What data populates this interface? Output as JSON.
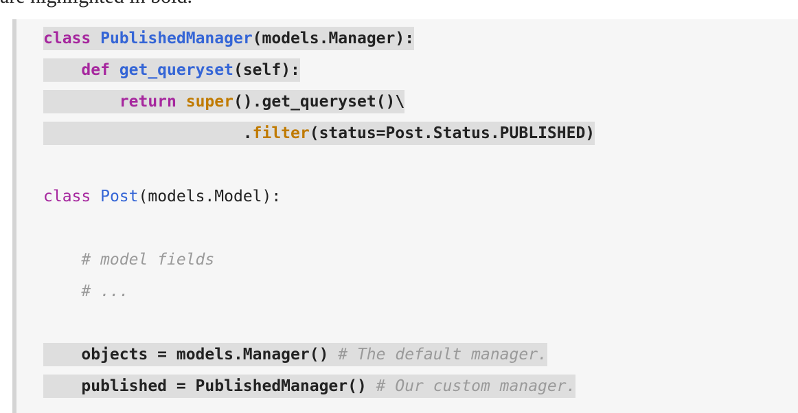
{
  "intro_text": "are highlighted in bold.",
  "code_lines": [
    {
      "highlighted": true,
      "tokens": [
        {
          "t": "class",
          "c": "kw"
        },
        {
          "t": " ",
          "c": "pl"
        },
        {
          "t": "PublishedManager",
          "c": "fn"
        },
        {
          "t": "(models.Manager):",
          "c": "pl"
        }
      ]
    },
    {
      "highlighted": true,
      "tokens": [
        {
          "t": "    ",
          "c": "pl"
        },
        {
          "t": "def",
          "c": "kw"
        },
        {
          "t": " ",
          "c": "pl"
        },
        {
          "t": "get_queryset",
          "c": "fn"
        },
        {
          "t": "(self):",
          "c": "pl"
        }
      ]
    },
    {
      "highlighted": true,
      "tokens": [
        {
          "t": "        ",
          "c": "pl"
        },
        {
          "t": "return",
          "c": "kw"
        },
        {
          "t": " ",
          "c": "pl"
        },
        {
          "t": "super",
          "c": "bi"
        },
        {
          "t": "().get_queryset()\\",
          "c": "pl"
        }
      ]
    },
    {
      "highlighted": true,
      "tokens": [
        {
          "t": "                     .",
          "c": "pl"
        },
        {
          "t": "filter",
          "c": "bi"
        },
        {
          "t": "(status=Post.Status.PUBLISHED)",
          "c": "pl"
        }
      ]
    },
    {
      "highlighted": false,
      "tokens": []
    },
    {
      "highlighted": false,
      "tokens": [
        {
          "t": "class",
          "c": "kw"
        },
        {
          "t": " ",
          "c": "pl"
        },
        {
          "t": "Post",
          "c": "fn"
        },
        {
          "t": "(models.Model):",
          "c": "pl"
        }
      ]
    },
    {
      "highlighted": false,
      "tokens": []
    },
    {
      "highlighted": false,
      "tokens": [
        {
          "t": "    ",
          "c": "pl"
        },
        {
          "t": "# model fields",
          "c": "cm"
        }
      ]
    },
    {
      "highlighted": false,
      "tokens": [
        {
          "t": "    ",
          "c": "pl"
        },
        {
          "t": "# ...",
          "c": "cm"
        }
      ]
    },
    {
      "highlighted": false,
      "tokens": []
    },
    {
      "highlighted": true,
      "tokens": [
        {
          "t": "    objects = models.Manager() ",
          "c": "pl"
        },
        {
          "t": "# The default manager.",
          "c": "cm"
        }
      ]
    },
    {
      "highlighted": true,
      "tokens": [
        {
          "t": "    published = PublishedManager() ",
          "c": "pl"
        },
        {
          "t": "# Our custom manager.",
          "c": "cm"
        }
      ]
    }
  ]
}
